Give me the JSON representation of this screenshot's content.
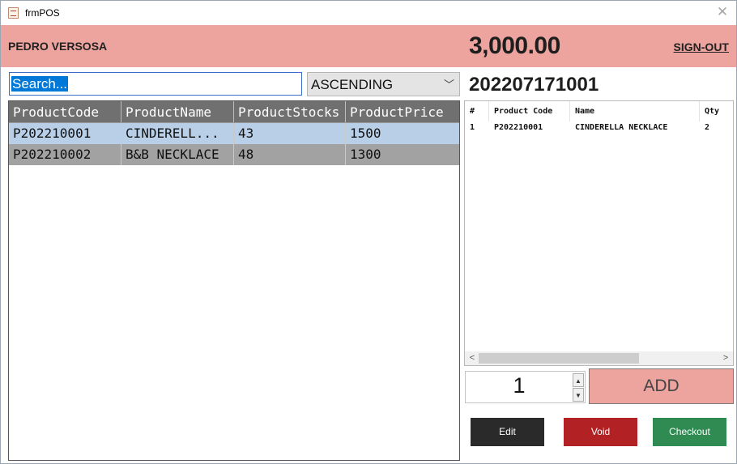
{
  "window": {
    "title": "frmPOS",
    "close_icon": "close-icon"
  },
  "header": {
    "user": "PEDRO VERSOSA",
    "total": "3,000.00",
    "signout_label": "SIGN-OUT",
    "color": "#eda49f"
  },
  "search": {
    "value": "Search...",
    "sort": "ASCENDING"
  },
  "product_grid": {
    "columns": [
      "ProductCode",
      "ProductName",
      "ProductStocks",
      "ProductPrice"
    ],
    "rows": [
      [
        "P202210001",
        "CINDERELL...",
        "43",
        "1500"
      ],
      [
        "P202210002",
        "B&B NECKLACE",
        "48",
        "1300"
      ]
    ]
  },
  "transaction": {
    "number": "202207171001",
    "columns": [
      "#",
      "Product Code",
      "Name",
      "Qty"
    ],
    "rows": [
      [
        "1",
        "P202210001",
        "CINDERELLA NECKLACE",
        "2"
      ]
    ]
  },
  "quantity": {
    "value": "1",
    "add_label": "ADD"
  },
  "actions": {
    "edit_label": "Edit",
    "void_label": "Void",
    "checkout_label": "Checkout",
    "colors": {
      "edit": "#2a2a2a",
      "void": "#b22225",
      "checkout": "#2f8b52"
    }
  }
}
